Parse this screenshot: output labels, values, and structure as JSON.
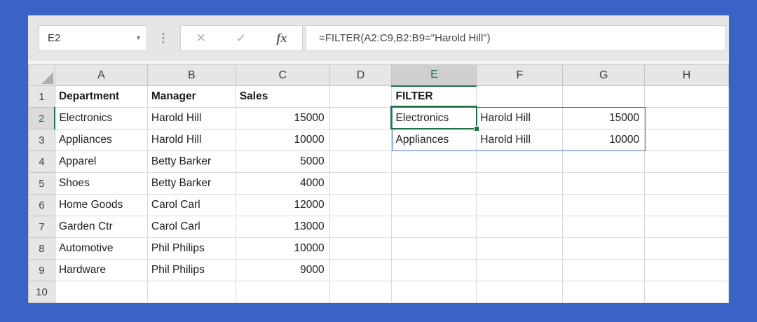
{
  "formula_bar": {
    "name_box_value": "E2",
    "name_box_dropdown_icon": "▾",
    "menu_dots_icon": "⋮",
    "cancel_icon": "✕",
    "enter_icon": "✓",
    "insert_function_icon": "fx",
    "formula": "=FILTER(A2:C9,B2:B9=\"Harold Hill\")"
  },
  "grid": {
    "column_headers": [
      "A",
      "B",
      "C",
      "D",
      "E",
      "F",
      "G",
      "H"
    ],
    "selected_column": "E",
    "selected_row_number": "2",
    "selected_cell_ref": "E2",
    "spill_range": "E2:G3",
    "rows": [
      {
        "num": "1",
        "cells": [
          {
            "v": "Department",
            "b": 1
          },
          {
            "v": "Manager",
            "b": 1
          },
          {
            "v": "Sales",
            "b": 1
          },
          "",
          {
            "v": "FILTER",
            "b": 1
          },
          "",
          "",
          ""
        ]
      },
      {
        "num": "2",
        "cells": [
          "Electronics",
          "Harold Hill",
          "15000",
          "",
          "Electronics",
          "Harold Hill",
          "15000",
          ""
        ]
      },
      {
        "num": "3",
        "cells": [
          "Appliances",
          "Harold Hill",
          "10000",
          "",
          "Appliances",
          "Harold Hill",
          "10000",
          ""
        ]
      },
      {
        "num": "4",
        "cells": [
          "Apparel",
          "Betty Barker",
          "5000",
          "",
          "",
          "",
          "",
          ""
        ]
      },
      {
        "num": "5",
        "cells": [
          "Shoes",
          "Betty Barker",
          "4000",
          "",
          "",
          "",
          "",
          ""
        ]
      },
      {
        "num": "6",
        "cells": [
          "Home Goods",
          "Carol Carl",
          "12000",
          "",
          "",
          "",
          "",
          ""
        ]
      },
      {
        "num": "7",
        "cells": [
          "Garden Ctr",
          "Carol Carl",
          "13000",
          "",
          "",
          "",
          "",
          ""
        ]
      },
      {
        "num": "8",
        "cells": [
          "Automotive",
          "Phil Philips",
          "10000",
          "",
          "",
          "",
          "",
          ""
        ]
      },
      {
        "num": "9",
        "cells": [
          "Hardware",
          "Phil Philips",
          "9000",
          "",
          "",
          "",
          "",
          ""
        ]
      },
      {
        "num": "10",
        "cells": [
          "",
          "",
          "",
          "",
          "",
          "",
          "",
          ""
        ]
      }
    ]
  },
  "colors": {
    "frame_blue": "#3A63C8",
    "excel_green": "#217346",
    "spill_border_blue": "#4472C4"
  }
}
